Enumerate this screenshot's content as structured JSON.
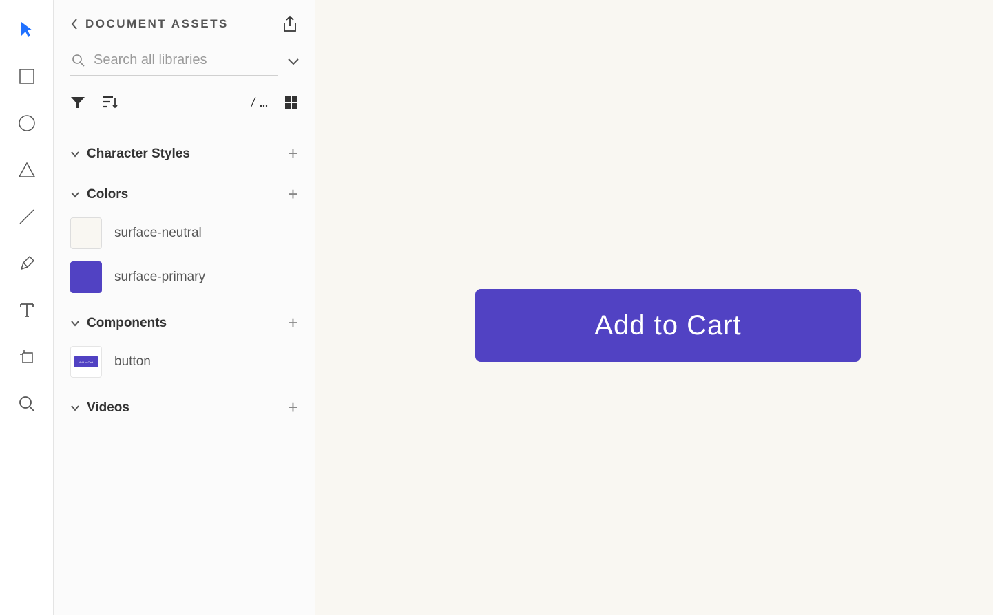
{
  "panel": {
    "title": "DOCUMENT ASSETS",
    "search_placeholder": "Search all libraries"
  },
  "sections": {
    "character_styles": {
      "title": "Character Styles"
    },
    "colors": {
      "title": "Colors",
      "items": [
        {
          "name": "surface-neutral",
          "hex": "#f9f7f2"
        },
        {
          "name": "surface-primary",
          "hex": "#5142c3"
        }
      ]
    },
    "components": {
      "title": "Components",
      "items": [
        {
          "name": "button",
          "thumb_label": "Add to Cart"
        }
      ]
    },
    "videos": {
      "title": "Videos"
    }
  },
  "canvas": {
    "button_label": "Add to Cart",
    "button_bg": "#5142c3"
  },
  "colors": {
    "accent_blue": "#2071ff",
    "primary": "#5142c3",
    "neutral_bg": "#f9f7f2"
  }
}
